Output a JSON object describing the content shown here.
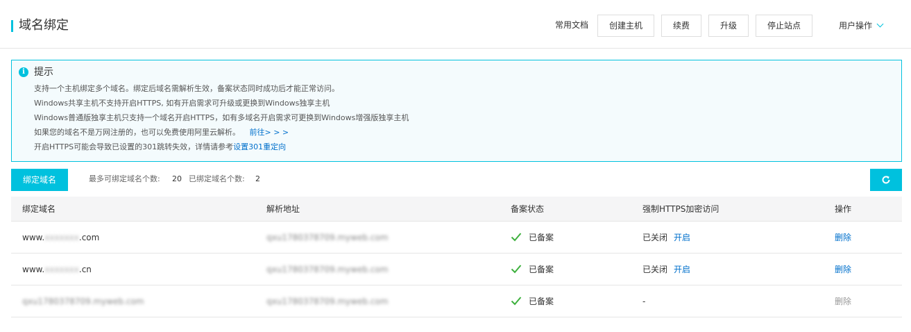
{
  "header": {
    "title": "域名绑定",
    "doc_link": "常用文档",
    "buttons": [
      "创建主机",
      "续费",
      "升级",
      "停止站点"
    ],
    "user_ops": "用户操作"
  },
  "notice": {
    "title": "提示",
    "lines": [
      "支持一个主机绑定多个域名。绑定后域名需解析生效，备案状态同时成功后才能正常访问。",
      "Windows共享主机不支持开启HTTPS, 如有开启需求可升级或更换到Windows独享主机",
      "Windows普通版独享主机只支持一个域名开启HTTPS，如有多域名开启需求可更换到Windows增强版独享主机",
      "如果您的域名不是万网注册的，也可以免费使用阿里云解析。"
    ],
    "line4_link": "前往> > >",
    "line5_text": "开启HTTPS可能会导致已设置的301跳转失效，详情请参考",
    "line5_link": "设置301重定向"
  },
  "toolbar": {
    "bind_button": "绑定域名",
    "max_label": "最多可绑定域名个数:",
    "max_value": "20",
    "bound_label": "已绑定域名个数:",
    "bound_value": "2"
  },
  "table": {
    "columns": [
      "绑定域名",
      "解析地址",
      "备案状态",
      "强制HTTPS加密访问",
      "操作"
    ],
    "rows": [
      {
        "domain_prefix": "www.",
        "domain_hidden": "xxxxxxx",
        "domain_suffix": ".com",
        "resolve": "qxu1780378709.myweb.com",
        "status": "已备案",
        "https_state": "已关闭",
        "https_action": "开启",
        "op": "删除"
      },
      {
        "domain_prefix": "www.",
        "domain_hidden": "xxxxxxx",
        "domain_suffix": ".cn",
        "resolve": "qxu1780378709.myweb.com",
        "status": "已备案",
        "https_state": "已关闭",
        "https_action": "开启",
        "op": "删除"
      },
      {
        "domain_full": "qxu1780378709.myweb.com",
        "resolve": "qxu1780378709.myweb.com",
        "status": "已备案",
        "https_state": "-",
        "op": "删除"
      }
    ]
  },
  "colors": {
    "accent": "#00c1de",
    "link": "#0070cc",
    "check": "#3db03d"
  }
}
